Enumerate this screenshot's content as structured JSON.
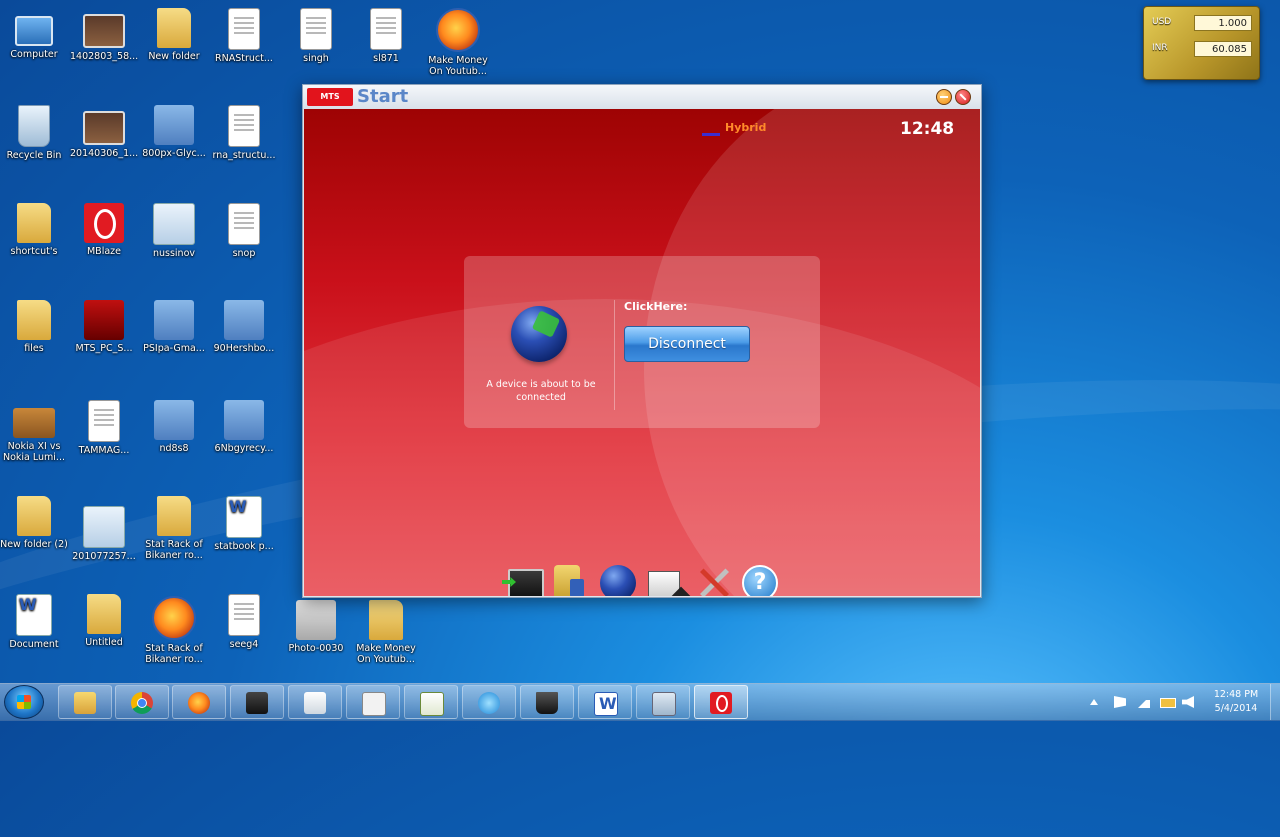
{
  "desktop": {
    "icons": [
      {
        "label": "Computer",
        "type": "computer"
      },
      {
        "label": "1402803_58...",
        "type": "photo"
      },
      {
        "label": "New folder",
        "type": "folder"
      },
      {
        "label": "RNAStruct...",
        "type": "doc"
      },
      {
        "label": "singh",
        "type": "doc"
      },
      {
        "label": "sl871",
        "type": "doc"
      },
      {
        "label": "Make Money On Youtub...",
        "type": "firefox"
      },
      {
        "label": "Recycle Bin",
        "type": "bin"
      },
      {
        "label": "20140306_1...",
        "type": "photo"
      },
      {
        "label": "800px-Glyc...",
        "type": "blue"
      },
      {
        "label": "rna_structu...",
        "type": "doc"
      },
      {
        "label": "shortcut's",
        "type": "folder"
      },
      {
        "label": "MBlaze",
        "type": "mblaze"
      },
      {
        "label": "nussinov",
        "type": "window"
      },
      {
        "label": "snop",
        "type": "doc"
      },
      {
        "label": "files",
        "type": "folder"
      },
      {
        "label": "MTS_PC_S...",
        "type": "red"
      },
      {
        "label": "PSIpa-Gma...",
        "type": "blue"
      },
      {
        "label": "90Hershbo...",
        "type": "blue"
      },
      {
        "label": "Nokia XI vs Nokia Lumi...",
        "type": "book"
      },
      {
        "label": "TAMMAG...",
        "type": "doc"
      },
      {
        "label": "nd8s8",
        "type": "blue"
      },
      {
        "label": "6Nbgyrecy...",
        "type": "blue"
      },
      {
        "label": "New folder (2)",
        "type": "folder"
      },
      {
        "label": "201077257...",
        "type": "window"
      },
      {
        "label": "Stat Rack of Bikaner ro...",
        "type": "folder"
      },
      {
        "label": "statbook p...",
        "type": "word"
      },
      {
        "label": "Document",
        "type": "word"
      },
      {
        "label": "Untitled",
        "type": "folder"
      },
      {
        "label": "Stat Rack of Bikaner ro...",
        "type": "firefox"
      },
      {
        "label": "seeg4",
        "type": "doc"
      },
      {
        "label": "Photo-0030",
        "type": "gray"
      },
      {
        "label": "Make Money On Youtub...",
        "type": "folder"
      }
    ]
  },
  "gadget": {
    "row1": {
      "code": "USD",
      "value": "1.000"
    },
    "row2": {
      "code": "INR",
      "value": "60.085"
    }
  },
  "app": {
    "logo": "MTS",
    "title": "Start",
    "network_mode": "Hybrid",
    "clock": "12:48",
    "status_text": "A device is about to be connected",
    "click_label": "ClickHere:",
    "disconnect_label": "Disconnect",
    "help_glyph": "?"
  },
  "taskbar": {
    "time": "12:48 PM",
    "date": "5/4/2014"
  },
  "colors": {
    "app_red": "#c9101a",
    "title_blue": "#5a86c8",
    "button_blue": "#4c9ce8",
    "network_orange": "#ff8a2a"
  }
}
